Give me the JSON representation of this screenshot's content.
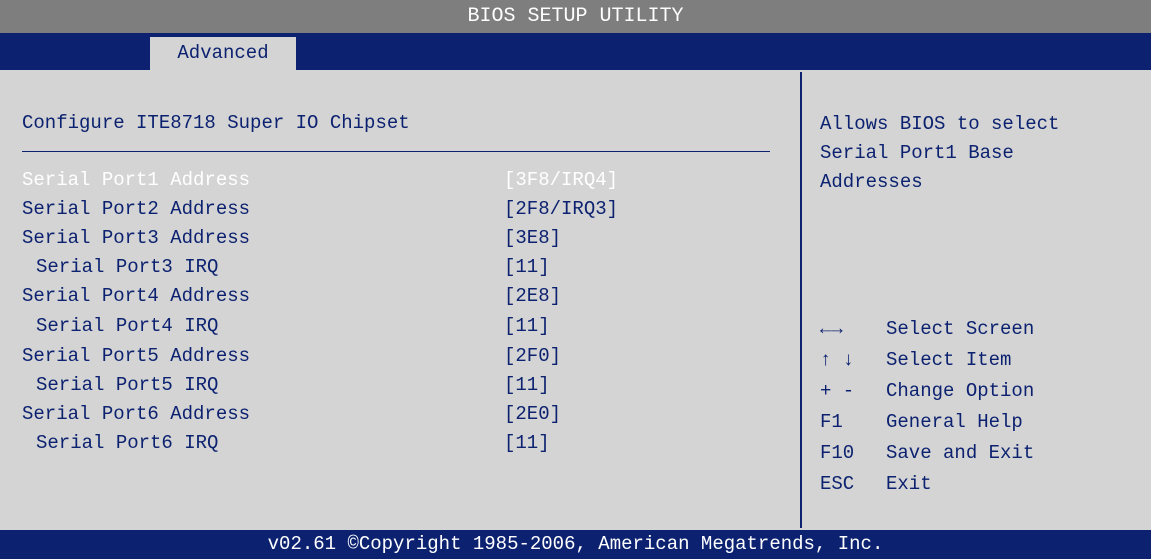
{
  "header": {
    "title": "BIOS SETUP UTILITY"
  },
  "tabs": [
    {
      "label": "Advanced",
      "active": true
    }
  ],
  "main": {
    "section_title": "Configure ITE8718 Super IO Chipset",
    "settings": [
      {
        "label": "Serial Port1 Address",
        "value": "[3F8/IRQ4]",
        "selected": true
      },
      {
        "label": "Serial Port2 Address",
        "value": "[2F8/IRQ3]"
      },
      {
        "label": "Serial Port3 Address",
        "value": "[3E8]"
      },
      {
        "label": "Serial Port3 IRQ",
        "value": "[11]",
        "sub": true
      },
      {
        "label": "Serial Port4 Address",
        "value": "[2E8]"
      },
      {
        "label": "Serial Port4 IRQ",
        "value": "[11]",
        "sub": true
      },
      {
        "label": "Serial Port5 Address",
        "value": "[2F0]"
      },
      {
        "label": "Serial Port5 IRQ",
        "value": "[11]",
        "sub": true
      },
      {
        "label": "Serial Port6 Address",
        "value": "[2E0]"
      },
      {
        "label": "Serial Port6 IRQ",
        "value": "[11]",
        "sub": true
      }
    ]
  },
  "help": {
    "lines": [
      "Allows BIOS to select",
      "Serial Port1 Base",
      "Addresses"
    ],
    "keys": [
      {
        "key": "←→",
        "action": "Select Screen"
      },
      {
        "key": "↑ ↓",
        "action": "Select Item"
      },
      {
        "key": "+ -",
        "action": "Change Option"
      },
      {
        "key": "F1",
        "action": "General Help"
      },
      {
        "key": "F10",
        "action": "Save and Exit"
      },
      {
        "key": "ESC",
        "action": "Exit"
      }
    ]
  },
  "footer": {
    "text": "v02.61 ©Copyright 1985-2006, American Megatrends, Inc."
  },
  "colors": {
    "background": "#d4d4d4",
    "text": "#0c2270",
    "title_bar": "#7e7e7e",
    "selected_text": "#ffffff"
  }
}
